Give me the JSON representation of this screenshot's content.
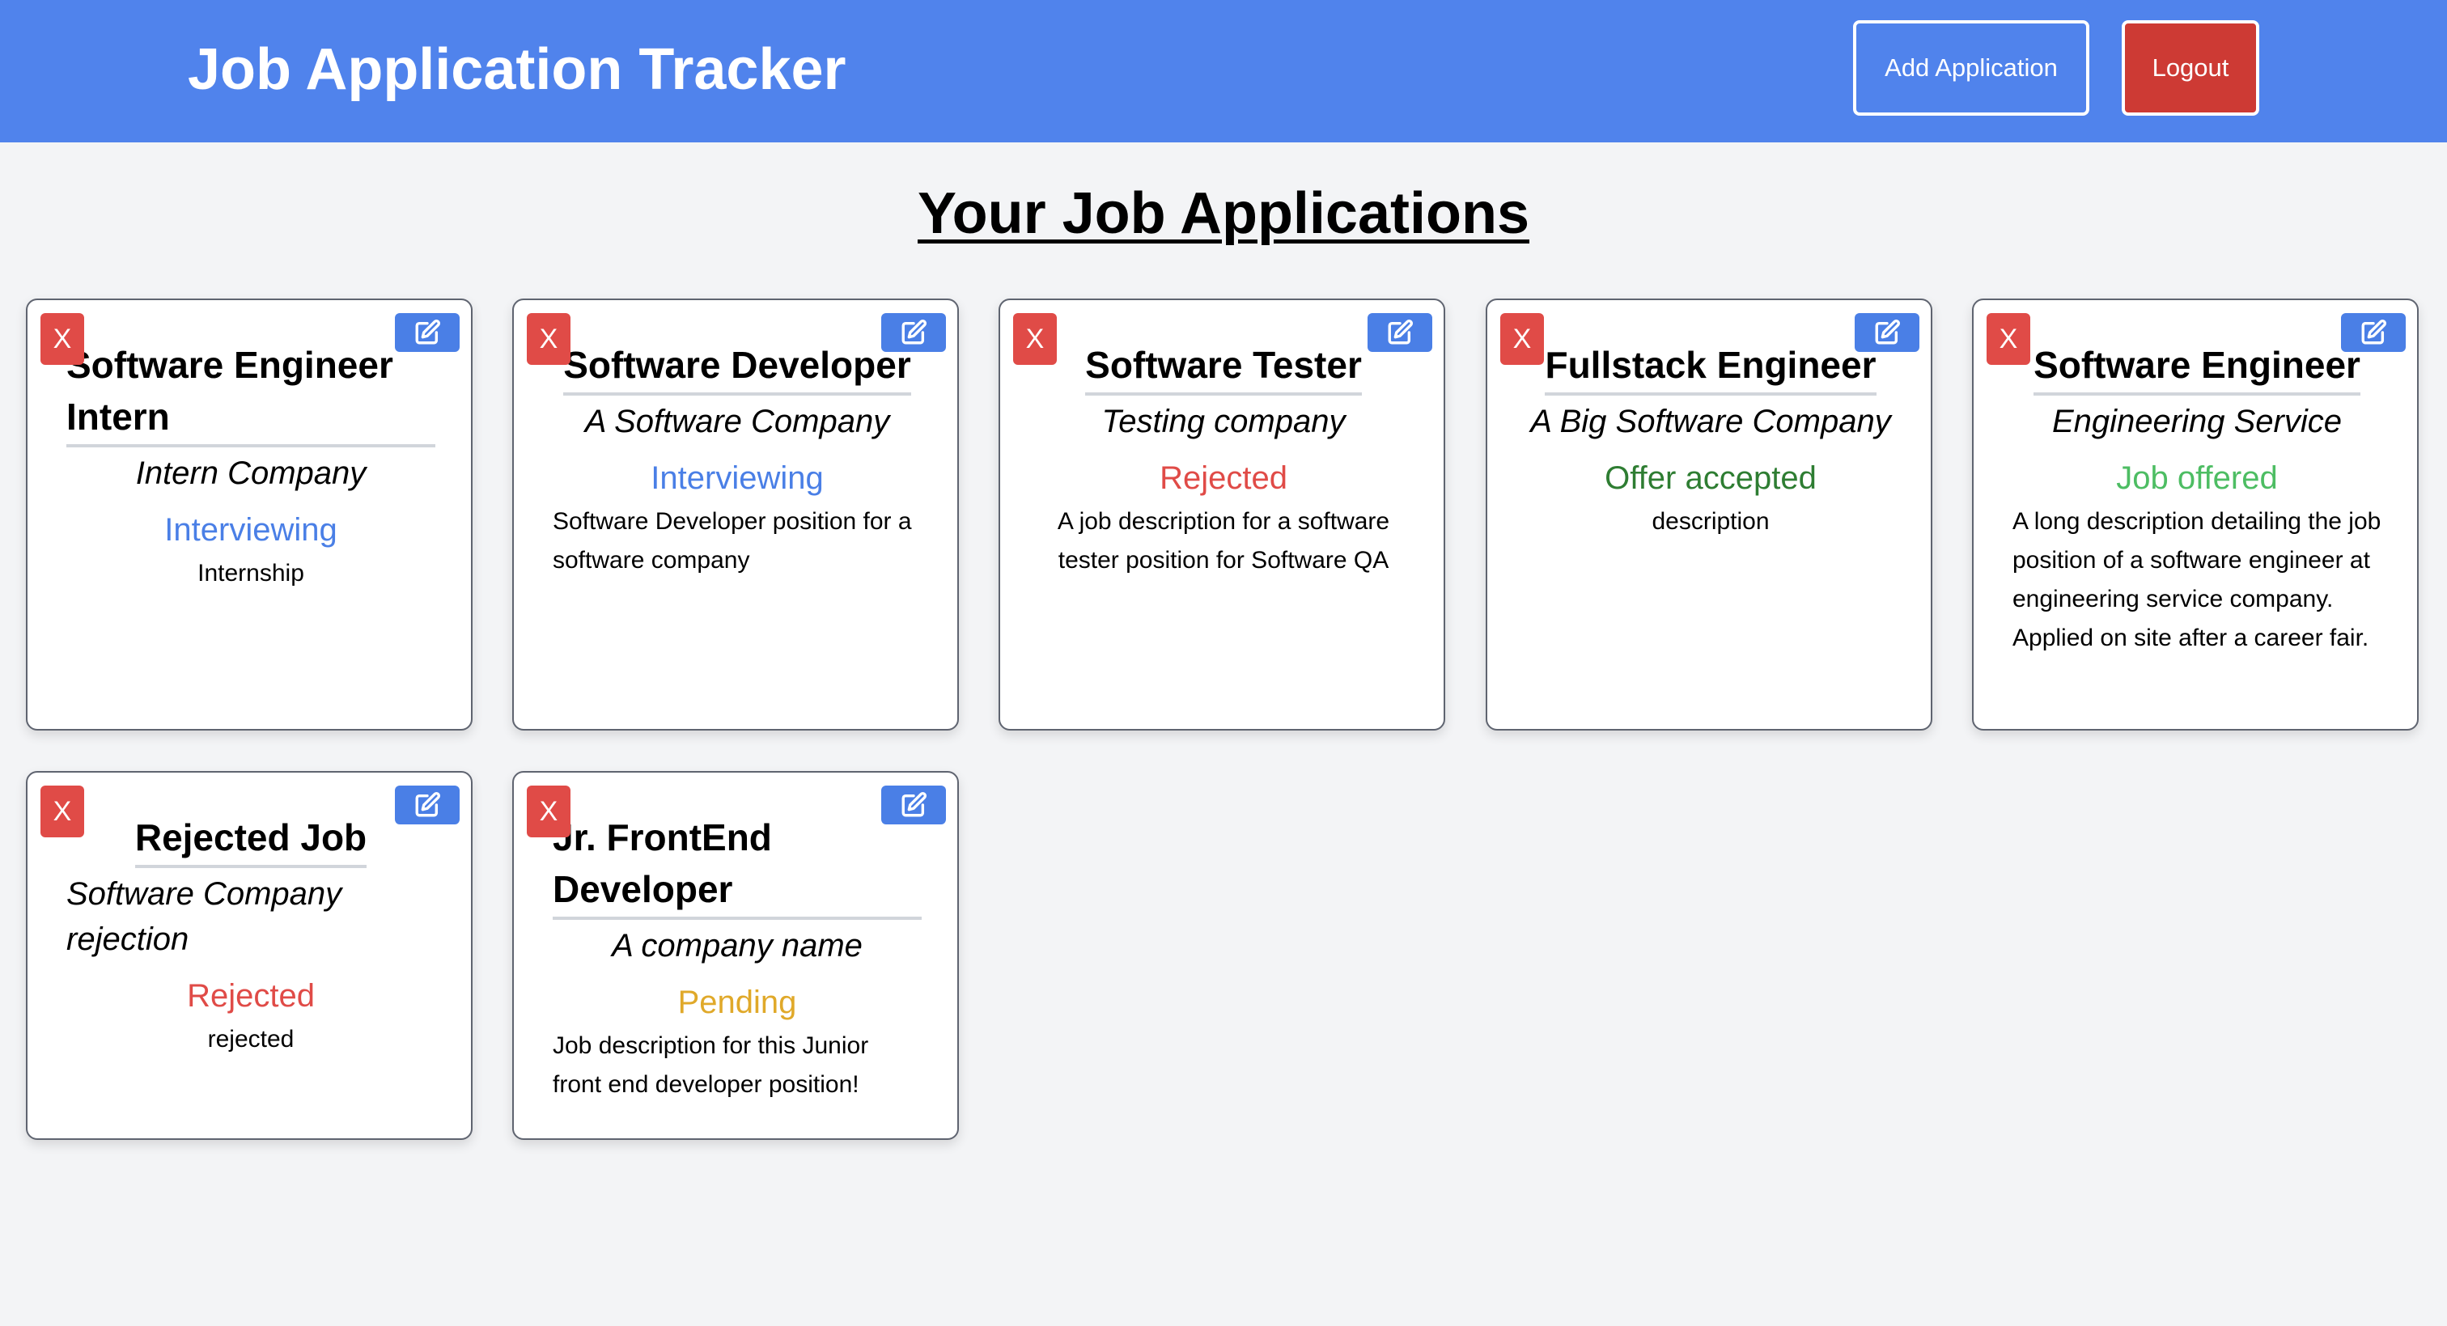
{
  "header": {
    "title": "Job Application Tracker",
    "add_label": "Add Application",
    "logout_label": "Logout"
  },
  "main": {
    "heading": "Your Job Applications"
  },
  "icons": {
    "delete": "close-icon",
    "edit": "edit-icon"
  },
  "colors": {
    "header": "#5083ec",
    "logout": "#cd3a34",
    "delete": "#e04b47",
    "edit": "#4a7fe6",
    "interviewing": "#4a7fe6",
    "rejected": "#e04b47",
    "offer_accepted": "#2e7d32",
    "job_offered": "#4dbd63",
    "pending": "#e0a92a"
  },
  "applications": [
    {
      "delete_label": "X",
      "title": "Software Engineer Intern",
      "company": "Intern Company",
      "status": "Interviewing",
      "description": "Internship"
    },
    {
      "delete_label": "X",
      "title": "Software Developer",
      "company": "A Software Company",
      "status": "Interviewing",
      "description": "Software Developer position for a software company"
    },
    {
      "delete_label": "X",
      "title": "Software Tester",
      "company": "Testing company",
      "status": "Rejected",
      "description": "A job description for a software tester position for Software QA"
    },
    {
      "delete_label": "X",
      "title": "Fullstack Engineer",
      "company": "A Big Software Company",
      "status": "Offer accepted",
      "description": "description"
    },
    {
      "delete_label": "X",
      "title": "Software Engineer",
      "company": "Engineering Service",
      "status": "Job offered",
      "description": "A long description detailing the job position of a software engineer at engineering service company. Applied on site after a career fair."
    },
    {
      "delete_label": "X",
      "title": "Rejected Job",
      "company": "Software Company rejection",
      "status": "Rejected",
      "description": "rejected"
    },
    {
      "delete_label": "X",
      "title": "Jr. FrontEnd Developer",
      "company": "A company name",
      "status": "Pending",
      "description": "Job description for this Junior front end developer position!"
    }
  ]
}
